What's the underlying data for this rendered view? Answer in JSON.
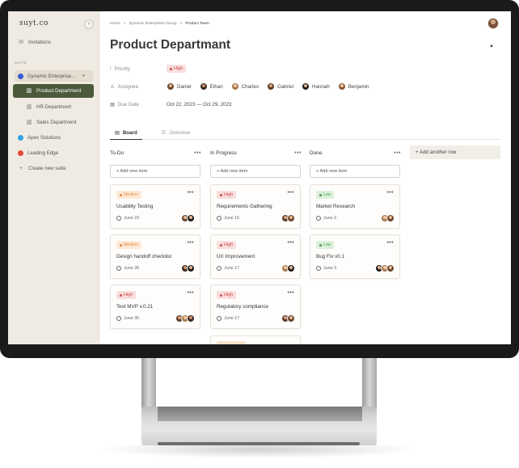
{
  "sidebar": {
    "logo": "suyt.co",
    "collapse": "‹",
    "invitations": "Invitations",
    "suite_label": "SUITE",
    "suites": [
      {
        "label": "Dynamic Enterprise...",
        "color": "#3a5bd9"
      },
      {
        "label": "Apex Solutions",
        "color": "#2fa3e6"
      },
      {
        "label": "Leading Edge",
        "color": "#e04a3a"
      }
    ],
    "departments": [
      "Product Department",
      "HR Department",
      "Sales Department"
    ],
    "create_suite": "Create new suite"
  },
  "header": {
    "breadcrumb": [
      "Home",
      ">",
      "Dynamic Enterprises Group",
      ">",
      "Product Team"
    ],
    "title": "Product Departmant"
  },
  "meta": {
    "priority_label": "Priority",
    "priority_value": "High",
    "assignee_label": "Assignee",
    "assignees": [
      "Daniel",
      "Ethan",
      "Charles",
      "Gabriel",
      "Hannah",
      "Benjamin"
    ],
    "due_label": "Due Date",
    "due_value": "Oct 22, 2023 — Oct 29, 2023"
  },
  "tabs": [
    "Board",
    "Overview"
  ],
  "board": {
    "add_item": "+ Add new item",
    "add_row": "+ Add another row",
    "columns": [
      {
        "name": "To-Do",
        "cards": [
          {
            "tag": "Medium",
            "title": "Usability Testing",
            "date": "June 23"
          },
          {
            "tag": "Medium",
            "title": "Design handoff checklist",
            "date": "June 26"
          },
          {
            "tag": "High",
            "title": "Test MVP v.0.21",
            "date": "June 30"
          }
        ]
      },
      {
        "name": "In Progress",
        "cards": [
          {
            "tag": "High",
            "title": "Requirements Gathering",
            "date": "June 15"
          },
          {
            "tag": "High",
            "title": "UX Improvement",
            "date": "June 17"
          },
          {
            "tag": "High",
            "title": "Regulatory compliance",
            "date": "June 17"
          }
        ]
      },
      {
        "name": "Done",
        "cards": [
          {
            "tag": "Low",
            "title": "Market Research",
            "date": "June 2"
          },
          {
            "tag": "Low",
            "title": "Bug Fix v0.1",
            "date": "June 3"
          }
        ]
      }
    ]
  }
}
